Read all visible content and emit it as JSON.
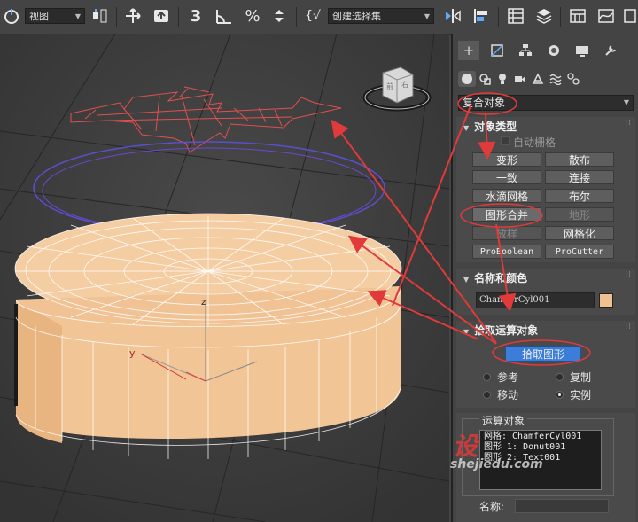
{
  "toolbar": {
    "view_select": "视图",
    "selection_set_placeholder": "创建选择集"
  },
  "panel": {
    "category_dropdown": "复合对象",
    "object_type": {
      "title": "对象类型",
      "autogrid": "自动栅格",
      "buttons": [
        "变形",
        "散布",
        "一致",
        "连接",
        "水滴网格",
        "布尔",
        "图形合并",
        "地形",
        "放样",
        "网格化",
        "ProBoolean",
        "ProCutter"
      ]
    },
    "name_color": {
      "title": "名称和颜色",
      "name": "ChamferCyl001",
      "color": "#f0c090"
    },
    "pick_operand": {
      "title": "拾取运算对象",
      "pick_button": "拾取图形",
      "options": [
        "参考",
        "复制",
        "移动",
        "实例"
      ]
    },
    "operands": {
      "title": "运算对象",
      "items": [
        "网格: ChamferCyl001",
        "图形 1: Donut001",
        "图形 2: Text001"
      ]
    },
    "name_label": "名称:"
  },
  "viewport": {
    "axis_y": "y",
    "axis_z": "z"
  },
  "watermark": {
    "big": "设",
    "url": "shejiedu.com"
  },
  "colors": {
    "accent": "#3b7dd8",
    "annotation": "#e03a3a",
    "object": "#f0c090"
  }
}
